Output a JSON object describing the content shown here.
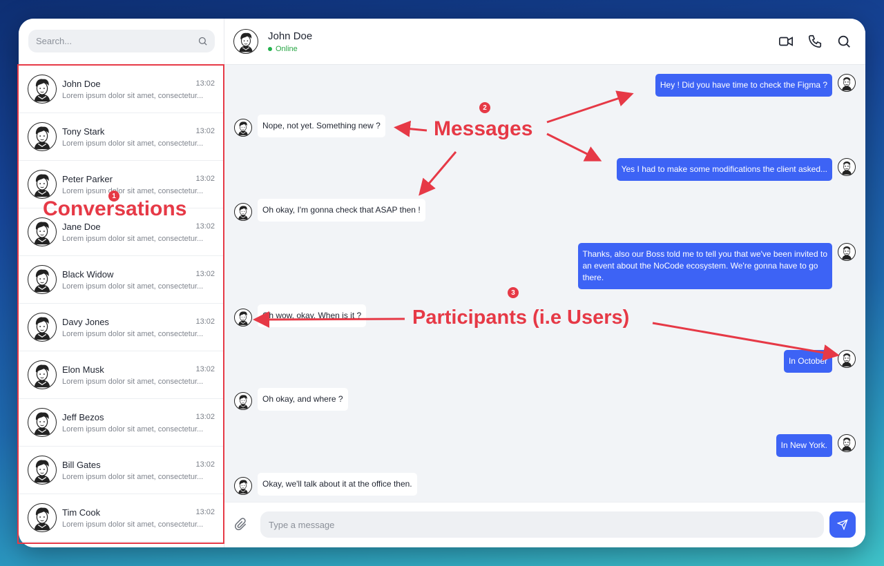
{
  "colors": {
    "accent": "#3d63f5",
    "online": "#22b14c",
    "annotation": "#e63946"
  },
  "sidebar": {
    "search_placeholder": "Search...",
    "conversations": [
      {
        "name": "John Doe",
        "time": "13:02",
        "preview": "Lorem ipsum dolor sit amet, consectetur..."
      },
      {
        "name": "Tony Stark",
        "time": "13:02",
        "preview": "Lorem ipsum dolor sit amet, consectetur..."
      },
      {
        "name": "Peter Parker",
        "time": "13:02",
        "preview": "Lorem ipsum dolor sit amet, consectetur..."
      },
      {
        "name": "Jane Doe",
        "time": "13:02",
        "preview": "Lorem ipsum dolor sit amet, consectetur..."
      },
      {
        "name": "Black Widow",
        "time": "13:02",
        "preview": "Lorem ipsum dolor sit amet, consectetur..."
      },
      {
        "name": "Davy Jones",
        "time": "13:02",
        "preview": "Lorem ipsum dolor sit amet, consectetur..."
      },
      {
        "name": "Elon Musk",
        "time": "13:02",
        "preview": "Lorem ipsum dolor sit amet, consectetur..."
      },
      {
        "name": "Jeff Bezos",
        "time": "13:02",
        "preview": "Lorem ipsum dolor sit amet, consectetur..."
      },
      {
        "name": "Bill Gates",
        "time": "13:02",
        "preview": "Lorem ipsum dolor sit amet, consectetur..."
      },
      {
        "name": "Tim Cook",
        "time": "13:02",
        "preview": "Lorem ipsum dolor sit amet, consectetur..."
      }
    ]
  },
  "header": {
    "name": "John Doe",
    "status": "Online",
    "icons": [
      "video-camera-icon",
      "phone-icon",
      "search-icon"
    ]
  },
  "messages": [
    {
      "from": "me",
      "text": "Hey ! Did you have time to check the Figma ?"
    },
    {
      "from": "them",
      "text": "Nope, not yet. Something new ?"
    },
    {
      "from": "me",
      "text": "Yes I had to make some modifications the client asked..."
    },
    {
      "from": "them",
      "text": "Oh okay, I'm gonna check that ASAP then !"
    },
    {
      "from": "me",
      "text": "Thanks, also our Boss told me to tell you that we've been invited to\nan event about the NoCode ecosystem. We're gonna have to go\nthere."
    },
    {
      "from": "them",
      "text": "Oh wow, okay. When is it ?"
    },
    {
      "from": "me",
      "text": "In October"
    },
    {
      "from": "them",
      "text": "Oh okay, and where ?"
    },
    {
      "from": "me",
      "text": "In New York."
    },
    {
      "from": "them",
      "text": "Okay, we'll talk about it at the office then."
    }
  ],
  "composer": {
    "placeholder": "Type a message",
    "icons": [
      "paperclip-icon",
      "send-icon"
    ]
  },
  "annotations": {
    "conversations": {
      "number": "1",
      "label": "Conversations"
    },
    "messages": {
      "number": "2",
      "label": "Messages"
    },
    "participants": {
      "number": "3",
      "label": "Participants (i.e Users)"
    }
  }
}
